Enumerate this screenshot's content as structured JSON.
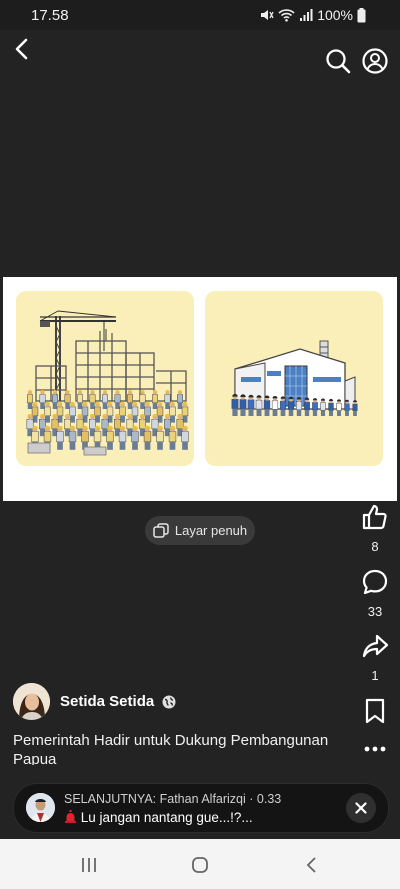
{
  "status": {
    "time": "17.58",
    "battery": "100%"
  },
  "post": {
    "fullscreen_label": "Layar penuh",
    "likes": "8",
    "comments": "33",
    "shares": "1",
    "author": "Setida Setida",
    "caption": "Pemerintah Hadir untuk Dukung Pembangunan Papua"
  },
  "next_up": {
    "label": "SELANJUTNYA: Fathan Alfarizqi · 0.33",
    "title": "Lu jangan nantang gue...!?..."
  },
  "colors": {
    "background": "#232323",
    "panel": "#fbefb9",
    "accent_blue": "#3b6fc4"
  }
}
